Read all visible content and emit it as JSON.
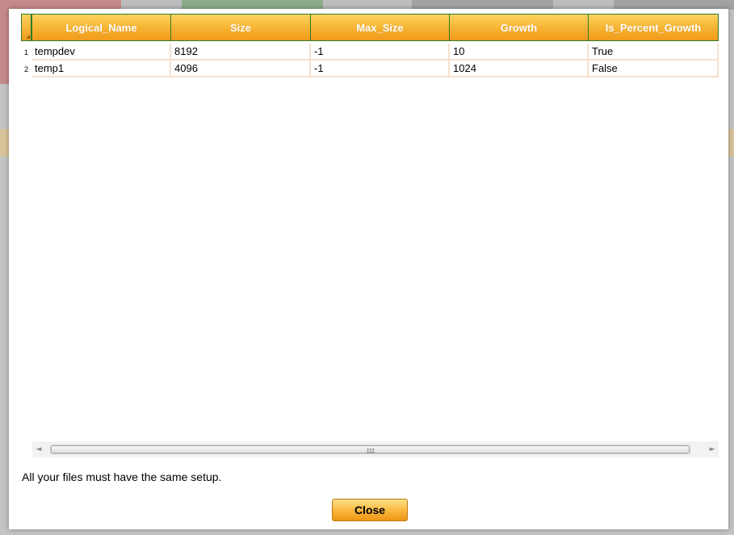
{
  "colors": {
    "header_gradient_top": "#fdd35f",
    "header_gradient_bottom": "#f19a1b",
    "header_border": "#2f7a2a",
    "row_divider": "#f6e1cc",
    "background_tile_red": "#c48a8a",
    "background_tile_green": "#8cab8c",
    "background_band": "#d9c49a"
  },
  "grid": {
    "columns": [
      {
        "key": "logical_name",
        "label": "Logical_Name"
      },
      {
        "key": "size",
        "label": "Size"
      },
      {
        "key": "max_size",
        "label": "Max_Size"
      },
      {
        "key": "growth",
        "label": "Growth"
      },
      {
        "key": "is_percent_growth",
        "label": "Is_Percent_Growth"
      }
    ],
    "rows": [
      {
        "num": "1",
        "cells": [
          "tempdev",
          "8192",
          "-1",
          "10",
          "True"
        ]
      },
      {
        "num": "2",
        "cells": [
          "temp1",
          "4096",
          "-1",
          "1024",
          "False"
        ]
      }
    ]
  },
  "scrollbar": {
    "left_arrow_icon": "chevron-left-icon",
    "right_arrow_icon": "chevron-right-icon",
    "left_arrow": "◄",
    "right_arrow": "►",
    "grip": "III"
  },
  "message": "All your files must have the same setup.",
  "buttons": {
    "close_label": "Close"
  }
}
